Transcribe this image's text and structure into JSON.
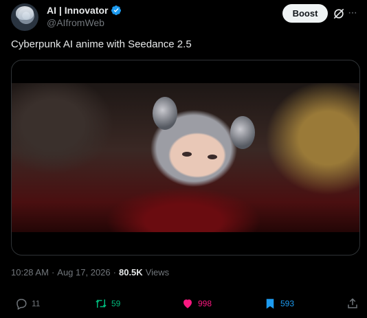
{
  "author": {
    "display_name": "AI | Innovator",
    "handle": "@AIfromWeb",
    "verified_color": "#1d9bf0"
  },
  "header_actions": {
    "boost_label": "Boost",
    "grok_icon": "grok-icon",
    "more_icon": "more-horizontal-icon"
  },
  "tweet": {
    "text": "Cyberpunk AI anime with Seedance 2.5",
    "time": "10:28 AM",
    "separator": "·",
    "date": "Aug 17, 2026",
    "views_count": "80.5K",
    "views_label": "Views"
  },
  "actions": {
    "replies": "11",
    "retweets": "59",
    "likes": "998",
    "bookmarks": "593"
  },
  "colors": {
    "background": "#000000",
    "text": "#e7e9ea",
    "muted": "#71767b",
    "retweet": "#00ba7c",
    "like": "#f91880",
    "bookmark": "#1d9bf0"
  }
}
